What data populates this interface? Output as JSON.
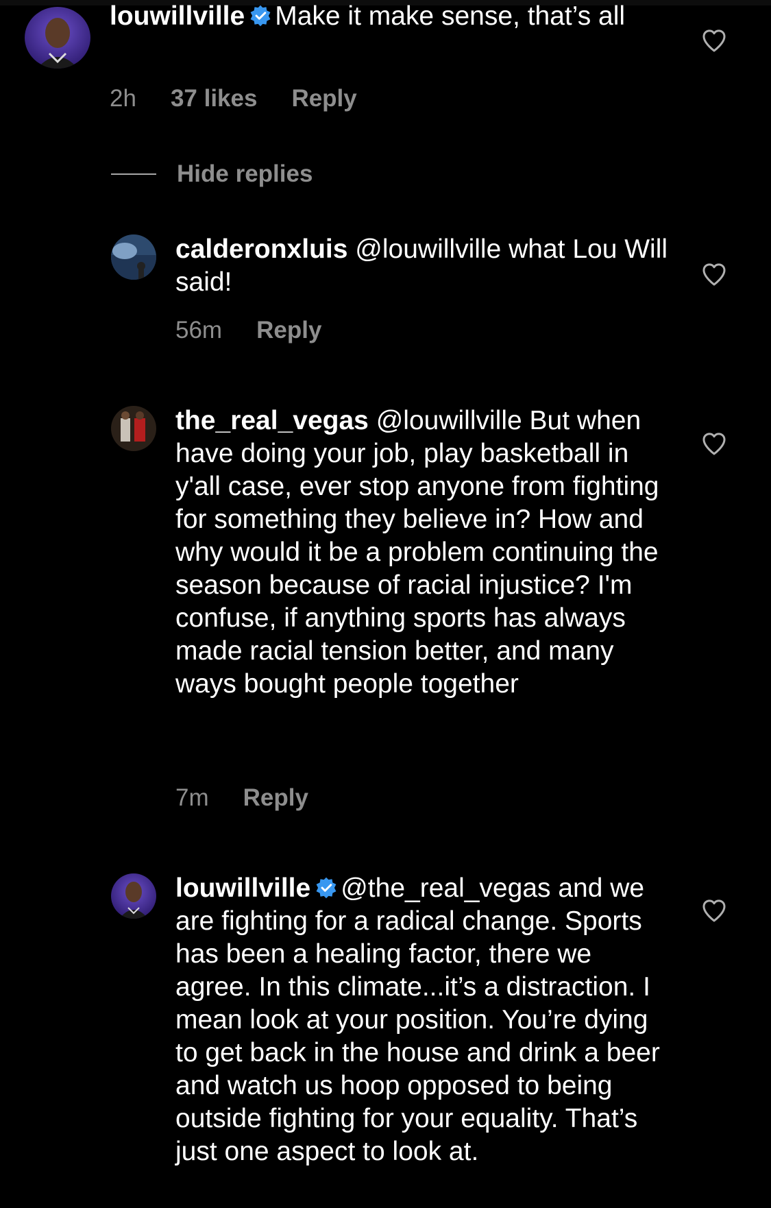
{
  "colors": {
    "background": "#000000",
    "text": "#ffffff",
    "meta": "#8e8e8e",
    "verified": "#3897f0"
  },
  "hide_replies_label": "Hide replies",
  "comments": [
    {
      "username": "louwillville",
      "verified": true,
      "mention": "",
      "text": "Make it make sense, that’s all",
      "time": "2h",
      "likes": "37 likes",
      "reply_label": "Reply",
      "icon": "heart-outline-icon"
    },
    {
      "username": "calderonxluis",
      "verified": false,
      "mention": "@louwillville",
      "text": "what Lou Will said!",
      "time": "56m",
      "likes": "",
      "reply_label": "Reply",
      "icon": "heart-outline-icon"
    },
    {
      "username": "the_real_vegas",
      "verified": false,
      "mention": "@louwillville",
      "text": "But when have doing your job, play basketball in y'all case, ever stop anyone from fighting for something they believe in? How and why would it be a problem continuing the season because of racial injustice? I'm confuse, if anything sports has always made racial tension better, and many ways bought people together",
      "time": "7m",
      "likes": "",
      "reply_label": "Reply",
      "icon": "heart-outline-icon"
    },
    {
      "username": "louwillville",
      "verified": true,
      "mention": "@the_real_vegas",
      "text": "and we are fighting for a radical change. Sports has been a healing factor, there we agree. In this climate...it’s a distraction. I mean look at your position. You’re dying to get back in the house and drink a beer and watch us hoop opposed to being outside fighting for your equality. That’s just one aspect to look at.",
      "time": "",
      "likes": "",
      "reply_label": "",
      "icon": "heart-outline-icon"
    }
  ]
}
